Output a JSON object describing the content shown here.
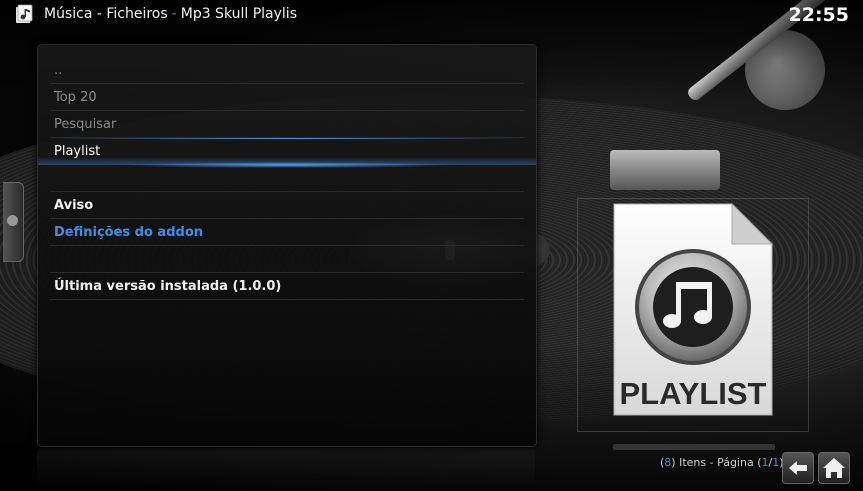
{
  "header": {
    "breadcrumb_root": "Música - Ficheiros",
    "breadcrumb_separator": "-",
    "breadcrumb_current": "Mp3 Skull Playlis",
    "clock": "22:55"
  },
  "list": {
    "items": [
      {
        "label": "..",
        "style": "dim"
      },
      {
        "label": "Top 20",
        "style": "dim"
      },
      {
        "label": "Pesquisar",
        "style": "dim"
      },
      {
        "label": "Playlist",
        "style": "selected"
      },
      {
        "label": "",
        "style": "empty"
      },
      {
        "label": "Aviso",
        "style": "white"
      },
      {
        "label": "Definições do addon",
        "style": "blue"
      },
      {
        "label": "",
        "style": "empty"
      },
      {
        "label": "Última versão instalada (1.0.0)",
        "style": "white"
      }
    ]
  },
  "thumbnail": {
    "icon": "music-note-icon",
    "caption": "PLAYLIST"
  },
  "footer": {
    "open_paren": "(",
    "item_count": "8",
    "items_text": ") Itens - Página (",
    "page_current": "1",
    "page_slash": "/",
    "page_total": "1",
    "close_paren": ")"
  },
  "colors": {
    "accent": "#3d8fe5",
    "selection": "#2f6fc0"
  }
}
